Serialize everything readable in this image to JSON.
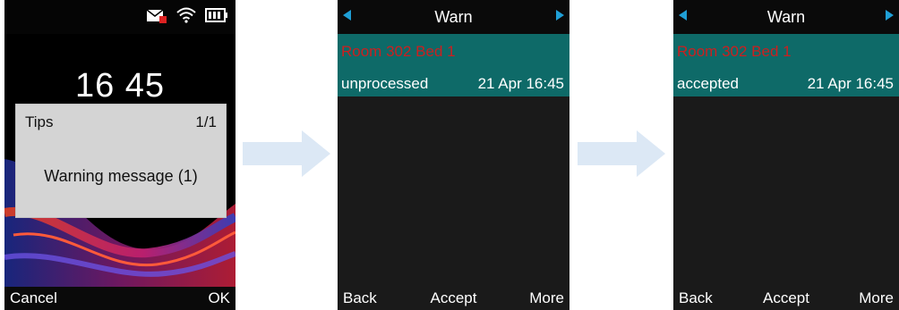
{
  "screen1": {
    "clock": "16 45",
    "dialog": {
      "title": "Tips",
      "page": "1/1",
      "message": "Warning message (1)"
    },
    "softkeys": {
      "left": "Cancel",
      "right": "OK"
    },
    "status_icons": [
      "mail-alert-icon",
      "wifi-icon",
      "battery-icon"
    ]
  },
  "screen2": {
    "title": "Warn",
    "item": {
      "location": "Room 302 Bed 1",
      "status": "unprocessed",
      "time": "21 Apr 16:45"
    },
    "softkeys": {
      "left": "Back",
      "center": "Accept",
      "right": "More"
    }
  },
  "screen3": {
    "title": "Warn",
    "item": {
      "location": "Room 302 Bed 1",
      "status": "accepted",
      "time": "21 Apr 16:45"
    },
    "softkeys": {
      "left": "Back",
      "center": "Accept",
      "right": "More"
    }
  },
  "colors": {
    "accent": "#1f9fd6",
    "selected_bg": "#0e6a68",
    "alert_text": "#cc1f1f",
    "dialog_bg": "#d4d4d4",
    "flow_arrow": "#dce8f5"
  }
}
